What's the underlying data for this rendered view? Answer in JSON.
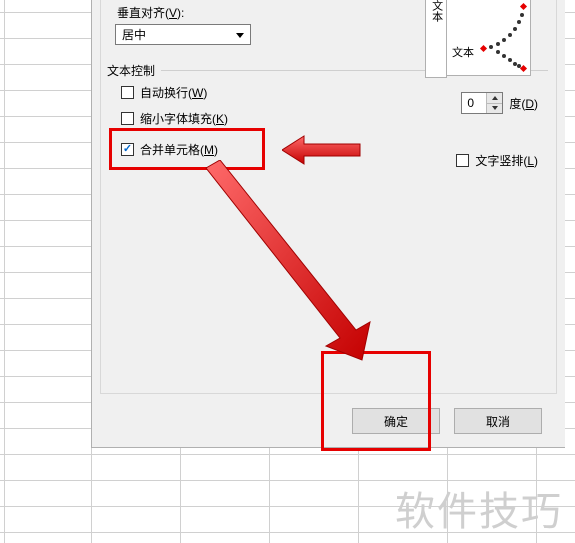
{
  "valign": {
    "label_pre": "垂直对齐(",
    "label_key": "V",
    "label_post": "):",
    "value": "居中"
  },
  "text_control": {
    "legend": "文本控制",
    "wrap_pre": "自动换行(",
    "wrap_key": "W",
    "wrap_post": ")",
    "shrink_pre": "缩小字体填充(",
    "shrink_key": "K",
    "shrink_post": ")",
    "merge_pre": "合并单元格(",
    "merge_key": "M",
    "merge_post": ")"
  },
  "orientation": {
    "left_label": "文本",
    "arc_label": "文本",
    "degree_value": "0",
    "degree_pre": "度(",
    "degree_key": "D",
    "degree_post": ")",
    "vtext_pre": "文字竖排(",
    "vtext_key": "L",
    "vtext_post": ")"
  },
  "buttons": {
    "ok": "确定",
    "cancel": "取消"
  },
  "watermark": "软件技巧",
  "annotations": {
    "merge_highlight_color": "#e60000",
    "ok_highlight_color": "#e60000"
  }
}
